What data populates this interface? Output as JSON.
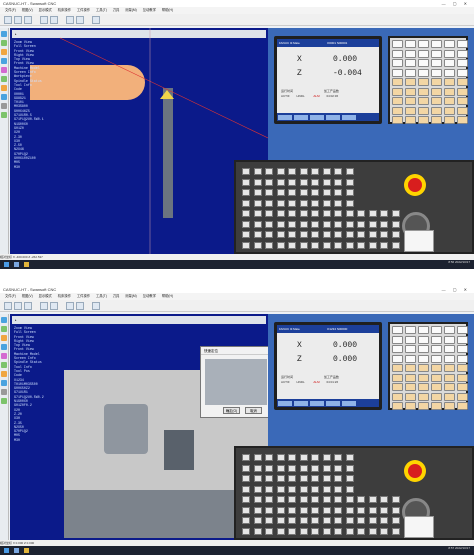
{
  "app_title": "CASNUC-HT - Swansoft CNC",
  "menu": [
    "文件(F)",
    "视图(V)",
    "显示模式",
    "机床操作",
    "工件操作",
    "工具(T)",
    "刀具",
    "测量(M)",
    "互动教学",
    "帮助(H)"
  ],
  "program_box": "SW-CNC",
  "brand_logo": "斯沃数控",
  "screens": [
    {
      "header_left": "FANUC 0i Mate",
      "header_right": "O0001    N00001",
      "axes": [
        {
          "name": "X",
          "value": "0.000"
        },
        {
          "name": "Z",
          "value": "-0.004"
        }
      ],
      "info_left": "运行时间",
      "info_right": "加工产品数",
      "status": "ACTIF",
      "mode": "HNDL",
      "alarm": "ALM",
      "clock": "04:02:36"
    },
    {
      "header_left": "FANUC 0i Mate",
      "header_right": "O1234    N00000",
      "axes": [
        {
          "name": "X",
          "value": "0.000"
        },
        {
          "name": "Z",
          "value": "0.000"
        }
      ],
      "info_left": "运行时间",
      "info_right": "加工产品数",
      "status": "ACTIF",
      "mode": "HNDL",
      "alarm": "ALM",
      "clock": "04:01:26"
    }
  ],
  "tree_1": [
    "Zoom View",
    "Full Screen",
    "Front View",
    "Right View",
    "Top View",
    "Front View",
    "Machine Model",
    "Screen Info",
    "Workpiece",
    "Spindle Status",
    "Tool Info",
    "Code",
    "O0001",
    "G98G21",
    "T0101",
    "M03S800",
    "G00X46Z5",
    "G71U1R0.5",
    "G71P1Q2U0.5W0.1",
    "N1G00X0",
    "G01Z0",
    "X20",
    "Z-30",
    "X30",
    "Z-50",
    "N2X46",
    "G70P1Q2",
    "G00X100Z100",
    "M05",
    "M30"
  ],
  "tree_2": [
    "Zoom View",
    "Full Screen",
    "Front View",
    "Right View",
    "Top View",
    "Front View",
    "Machine Model",
    "Screen Info",
    "Spindle Status",
    "Tool Info",
    "Tool Pos",
    "Code",
    "O1234",
    "T0101M03S500",
    "G00X50Z2",
    "G71U1R1",
    "G71P1Q2U0.5W0.2",
    "N1G00X0",
    "G01Z0F0.2",
    "X20",
    "Z-20",
    "X30",
    "Z-35",
    "N2X50",
    "G70P1Q2",
    "M05",
    "M30"
  ],
  "dialog_title": "快速定位",
  "dialog_ok": "确定(O)",
  "dialog_cancel": "取消",
  "status_bar_1": "相对坐标 X -400.000 Z -262.537",
  "status_bar_2": "相对坐标 X 0.000 Z 0.000",
  "taskbar_time_1": "8:56\n2022/10/17",
  "taskbar_time_2": "8:57\n2022/10/17",
  "colors": {
    "viewport": "#0b1a8a",
    "panel": "#3a69b8",
    "workpiece": "#f2b07b",
    "estop": "#d81e1e"
  }
}
